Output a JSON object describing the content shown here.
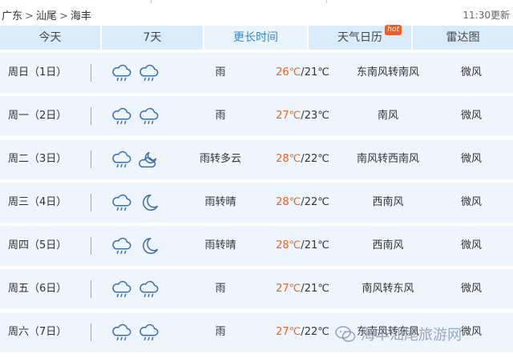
{
  "breadcrumb": [
    "广东",
    "汕尾",
    "海丰"
  ],
  "update_time": "11:30更新",
  "tabs": [
    {
      "label": "今天"
    },
    {
      "label": "7天"
    },
    {
      "label": "更长时间",
      "active": true
    },
    {
      "label": "天气日历",
      "badge": "hot"
    },
    {
      "label": "雷达图"
    }
  ],
  "forecast": [
    {
      "day": "周日（1日）",
      "icon_day": "rain-cloud-icon",
      "icon_night": "rain-cloud-icon",
      "weather": "雨",
      "high": "26℃",
      "low": "21℃",
      "wind_dir": "东南风转南风",
      "wind_level": "微风"
    },
    {
      "day": "周一（2日）",
      "icon_day": "rain-cloud-icon",
      "icon_night": "rain-cloud-icon",
      "weather": "雨",
      "high": "27℃",
      "low": "23℃",
      "wind_dir": "南风",
      "wind_level": "微风"
    },
    {
      "day": "周二（3日）",
      "icon_day": "rain-cloud-icon",
      "icon_night": "partly-cloudy-night-icon",
      "weather": "雨转多云",
      "high": "28℃",
      "low": "22℃",
      "wind_dir": "南风转西南风",
      "wind_level": "微风"
    },
    {
      "day": "周三（4日）",
      "icon_day": "rain-cloud-icon",
      "icon_night": "moon-icon",
      "weather": "雨转晴",
      "high": "28℃",
      "low": "22℃",
      "wind_dir": "西南风",
      "wind_level": "微风"
    },
    {
      "day": "周四（5日）",
      "icon_day": "rain-cloud-icon",
      "icon_night": "moon-icon",
      "weather": "雨转晴",
      "high": "28℃",
      "low": "21℃",
      "wind_dir": "西南风",
      "wind_level": "微风"
    },
    {
      "day": "周五（6日）",
      "icon_day": "rain-cloud-icon",
      "icon_night": "rain-cloud-icon",
      "weather": "雨",
      "high": "27℃",
      "low": "21℃",
      "wind_dir": "南风转东风",
      "wind_level": "微风"
    },
    {
      "day": "周六（7日）",
      "icon_day": "rain-cloud-icon",
      "icon_night": "rain-cloud-icon",
      "weather": "雨",
      "high": "27℃",
      "low": "22℃",
      "wind_dir": "东南风转东风",
      "wind_level": "微风"
    }
  ],
  "watermark": "海丰汕尾旅游网",
  "colors": {
    "accent": "#3a86d0",
    "temp_high": "#e8661c",
    "tab_bg": "#d9ecfa",
    "row_bg": "#eef5fc",
    "icon_stroke": "#3b6fa8"
  }
}
